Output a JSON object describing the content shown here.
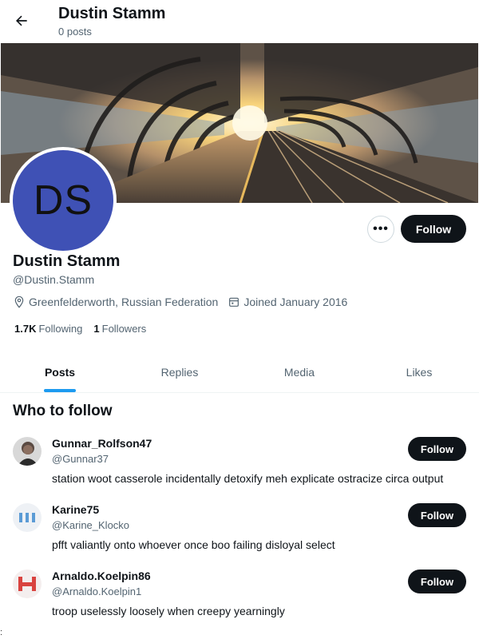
{
  "header": {
    "title": "Dustin Stamm",
    "posts_count": "0 posts"
  },
  "profile": {
    "avatar_initials": "DS",
    "avatar_color": "#3f51b5",
    "display_name": "Dustin Stamm",
    "handle": "@Dustin.Stamm",
    "location": "Greenfelderworth, Russian Federation",
    "joined": "Joined January 2016",
    "following_count": "1.7K",
    "following_label": "Following",
    "followers_count": "1",
    "followers_label": "Followers",
    "follow_label": "Follow",
    "more_label": "•••"
  },
  "tabs": [
    {
      "label": "Posts",
      "active": true
    },
    {
      "label": "Replies",
      "active": false
    },
    {
      "label": "Media",
      "active": false
    },
    {
      "label": "Likes",
      "active": false
    }
  ],
  "who_to_follow": {
    "title": "Who to follow",
    "items": [
      {
        "name": "Gunnar_Rolfson47",
        "handle": "@Gunnar37",
        "bio": "station woot casserole incidentally detoxify meh explicate ostracize circa output",
        "follow_label": "Follow",
        "avatar": "photo-avatar"
      },
      {
        "name": "Karine75",
        "handle": "@Karine_Klocko",
        "bio": "pfft valiantly onto whoever once boo failing disloyal select",
        "follow_label": "Follow",
        "avatar": "blue-bars-avatar"
      },
      {
        "name": "Arnaldo.Koelpin86",
        "handle": "@Arnaldo.Koelpin1",
        "bio": "troop uselessly loosely when creepy yearningly",
        "follow_label": "Follow",
        "avatar": "red-h-avatar"
      }
    ]
  },
  "stray_text": ":",
  "colors": {
    "accent": "#1d9bf0",
    "button_dark": "#0f1419",
    "muted_text": "#536471"
  },
  "icons": {
    "back": "arrow-left-icon",
    "location": "location-pin-icon",
    "calendar": "calendar-icon"
  }
}
